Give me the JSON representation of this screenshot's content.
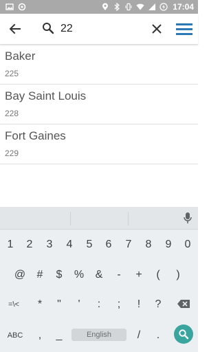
{
  "status_bar": {
    "time": "17:04",
    "icons": [
      "image-icon",
      "sync-icon",
      "location-icon",
      "bluetooth-icon",
      "vibrate-icon",
      "wifi-icon",
      "signal-icon",
      "battery-icon"
    ]
  },
  "app_bar": {
    "back_icon": "arrow-left-icon",
    "search_icon": "search-icon",
    "search_value": "22",
    "clear_icon": "close-icon",
    "menu_icon": "hamburger-menu-icon",
    "accent": "#2a78b5"
  },
  "results": [
    {
      "name": "Baker",
      "code": "225"
    },
    {
      "name": "Bay Saint Louis",
      "code": "228"
    },
    {
      "name": "Fort Gaines",
      "code": "229"
    }
  ],
  "keyboard": {
    "row1": [
      "1",
      "2",
      "3",
      "4",
      "5",
      "6",
      "7",
      "8",
      "9",
      "0"
    ],
    "row2": [
      "@",
      "#",
      "$",
      "%",
      "&",
      "-",
      "+",
      "(",
      ")"
    ],
    "row3": [
      "=\\<",
      "*",
      "\"",
      "'",
      ":",
      ";",
      "!",
      "?"
    ],
    "row4": {
      "abc": "ABC",
      "comma": ",",
      "underscore": "_",
      "space": "English",
      "slash": "/",
      "period": "."
    },
    "action_color": "#3aa59f"
  }
}
